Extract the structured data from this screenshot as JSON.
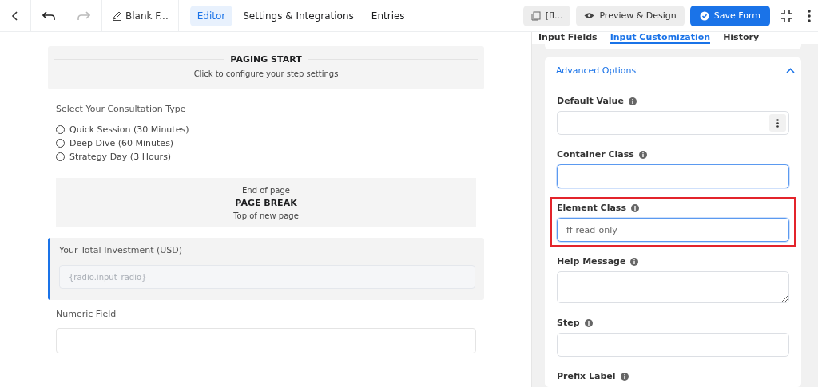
{
  "toolbar": {
    "form_title": "Blank F...",
    "tabs": [
      {
        "label": "Editor",
        "selected": true
      },
      {
        "label": "Settings & Integrations",
        "selected": false
      },
      {
        "label": "Entries",
        "selected": false
      }
    ],
    "shortcode_button": "[fl...",
    "preview_button": "Preview & Design",
    "save_button": "Save Form"
  },
  "canvas": {
    "paging_start": {
      "title": "PAGING START",
      "subtitle": "Click to configure your step settings"
    },
    "radio_question": {
      "label": "Select Your Consultation Type",
      "options": [
        {
          "label": "Quick Session (30 Minutes)",
          "selected": false
        },
        {
          "label": "Deep Dive (60 Minutes)",
          "selected": false
        },
        {
          "label": "Strategy Day (3 Hours)",
          "selected": false
        }
      ]
    },
    "page_break": {
      "before": "End of page",
      "title": "PAGE BREAK",
      "after": "Top of new page"
    },
    "calculated_field": {
      "label": "Your Total Investment (USD)",
      "placeholder": "{radio.input_radio}",
      "selected": true
    },
    "numeric_field": {
      "label": "Numeric Field"
    }
  },
  "panel": {
    "tabs": [
      {
        "label": "Input Fields",
        "selected": false
      },
      {
        "label": "Input Customization",
        "selected": true
      },
      {
        "label": "History",
        "selected": false
      }
    ],
    "section": {
      "title": "Advanced Options",
      "expanded": true
    },
    "fields": [
      {
        "kind": "menu-input",
        "label": "Default Value",
        "focused": false,
        "highlighted": false
      },
      {
        "kind": "input",
        "label": "Container Class",
        "focused": true,
        "highlighted": false
      },
      {
        "kind": "input",
        "label": "Element Class",
        "placeholder": "ff-read-only",
        "focused": true,
        "highlighted": true
      },
      {
        "kind": "textarea",
        "label": "Help Message",
        "focused": false,
        "highlighted": false
      },
      {
        "kind": "input",
        "label": "Step",
        "focused": false,
        "highlighted": false
      },
      {
        "kind": "label-only",
        "label": "Prefix Label",
        "focused": false,
        "highlighted": false
      }
    ]
  }
}
